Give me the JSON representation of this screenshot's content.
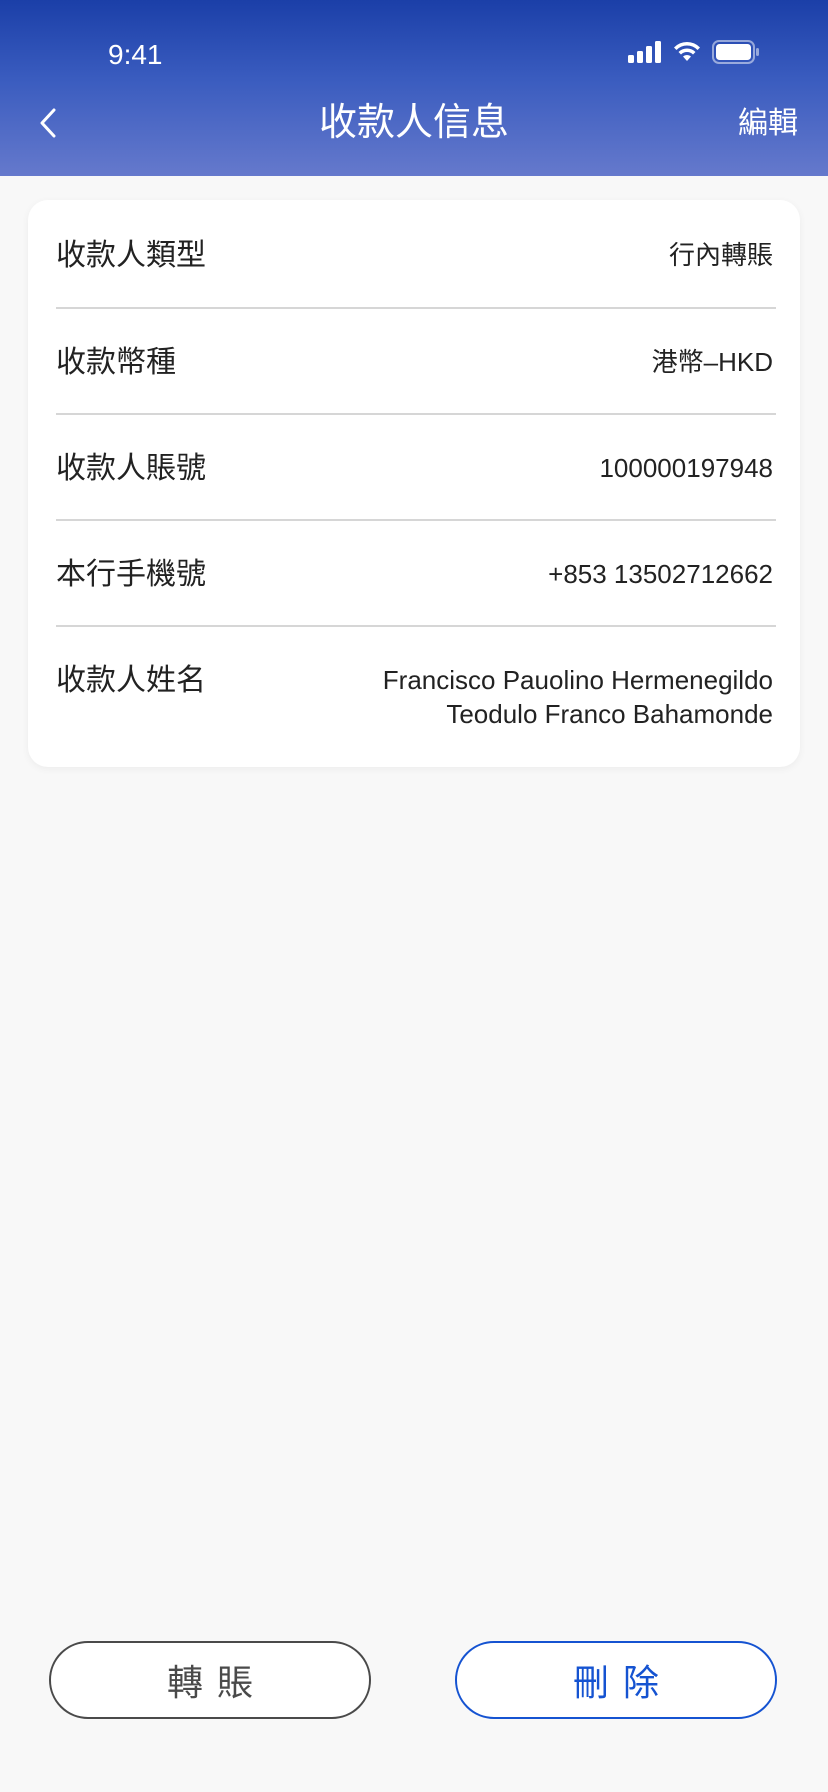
{
  "status_bar": {
    "time": "9:41",
    "icons": [
      "cellular-signal-icon",
      "wifi-icon",
      "battery-icon"
    ]
  },
  "nav": {
    "back_icon": "chevron-left-icon",
    "title": "收款人信息",
    "edit_label": "編輯"
  },
  "details": [
    {
      "label": "收款人類型",
      "value": "行內轉賬"
    },
    {
      "label": "收款幣種",
      "value": "港幣–HKD"
    },
    {
      "label": "收款人賬號",
      "value": "100000197948"
    },
    {
      "label": "本行手機號",
      "value": "+853 13502712662"
    },
    {
      "label": "收款人姓名",
      "value_line1": "Francisco Pauolino Hermenegildo",
      "value_line2": "Teodulo Franco Bahamonde"
    }
  ],
  "actions": {
    "transfer_label": "轉賬",
    "delete_label": "刪除"
  },
  "colors": {
    "header_top": "#1b3fa8",
    "header_bottom": "#6579cc",
    "delete_accent": "#1553d1",
    "transfer_border": "#4a4a4a",
    "page_background": "#f8f8f8"
  }
}
